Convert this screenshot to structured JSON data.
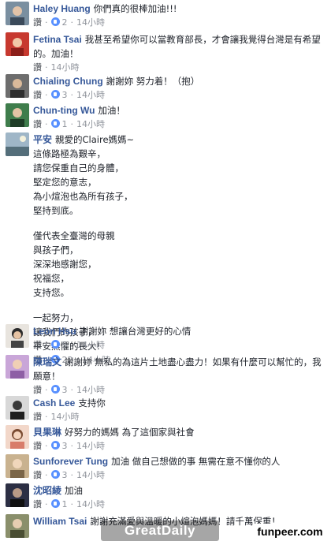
{
  "like_label": "讚",
  "comments": [
    {
      "name": "Haley Huang",
      "text": "你們真的很棒加油!!!",
      "count": "2",
      "time": "14小時"
    },
    {
      "name": "Fetina Tsai",
      "text": "我甚至希望你可以當教育部長，才會讓我覺得台灣是有希望的。加油！",
      "count": "",
      "time": "14小時"
    },
    {
      "name": "Chialing Chung",
      "text": "謝謝妳 努力着！（抱）",
      "count": "3",
      "time": "14小時"
    },
    {
      "name": "Chun-ting Wu",
      "text": "加油！",
      "count": "1",
      "time": "14小時"
    },
    {
      "name": "平安",
      "text": "親愛的Claire媽媽~",
      "poem": [
        "這條路極為艱辛，",
        "請您保重自己的身體，",
        "堅定您的意志，",
        "為小煊泡也為所有孩子，",
        "堅持到底。",
        "",
        "僅代表全臺灣的母親",
        "與孩子們，",
        "深深地感謝您，",
        "祝福您，",
        "支持您。",
        "",
        "一起努力，",
        "讓我們的孩子，",
        "平安無懼的長大!"
      ],
      "count": "22",
      "time": "14小時"
    },
    {
      "name": "Leon Hsu",
      "text": "謝謝妳 想讓台灣更好的心情",
      "count": "5",
      "time": "14小時"
    },
    {
      "name": "陳瑞文",
      "text": "謝謝妳 無私的為這片土地盡心盡力！如果有什麼可以幫忙的，我願意！",
      "count": "3",
      "time": "14小時"
    },
    {
      "name": "Cash Lee",
      "text": "支持你",
      "count": "",
      "time": "14小時"
    },
    {
      "name": "貝果琳",
      "text": "好努力的媽媽 為了這個家與社會",
      "count": "3",
      "time": "14小時"
    },
    {
      "name": "Sunforever Tung",
      "text": "加油 做自己想做的事 無需在意不懂你的人",
      "count": "3",
      "time": "14小時"
    },
    {
      "name": "沈昭綾",
      "text": "加油",
      "count": "1",
      "time": "14小時"
    },
    {
      "name": "William Tsai",
      "text": "謝謝充滿愛與溫暖的小煊泡媽媽！請千萬保重！",
      "count": "",
      "time": ""
    }
  ],
  "watermarks": {
    "left": "GreatDaily",
    "right": "funpeer.com"
  }
}
